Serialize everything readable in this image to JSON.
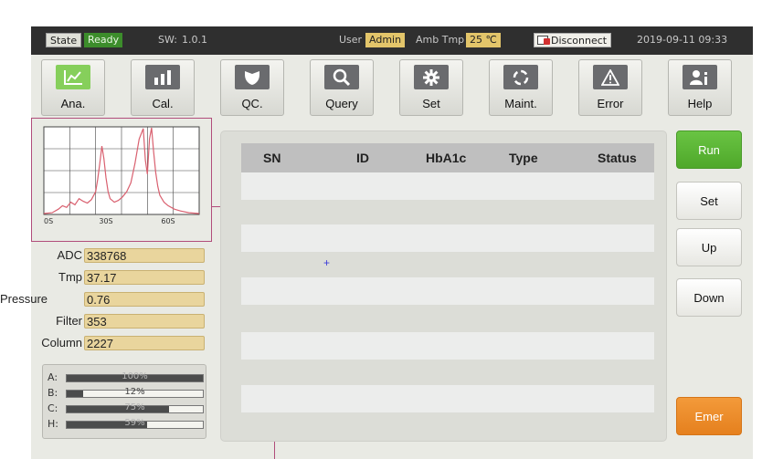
{
  "statusbar": {
    "state_label": "State",
    "state_value": "Ready",
    "sw_label": "SW:",
    "sw_version": "1.0.1",
    "user_label": "User",
    "user_value": "Admin",
    "amb_label": "Amb Tmp",
    "amb_value": "25 ℃",
    "connection": "Disconnect",
    "datetime": "2019-09-11 09:33"
  },
  "toolbar": [
    {
      "label": "Ana.",
      "icon": "line-chart-icon",
      "active": true
    },
    {
      "label": "Cal.",
      "icon": "bar-chart-icon",
      "active": false
    },
    {
      "label": "QC.",
      "icon": "shield-icon",
      "active": false
    },
    {
      "label": "Query",
      "icon": "search-icon",
      "active": false
    },
    {
      "label": "Set",
      "icon": "gear-icon",
      "active": false
    },
    {
      "label": "Maint.",
      "icon": "cycle-icon",
      "active": false
    },
    {
      "label": "Error",
      "icon": "warning-icon",
      "active": false
    },
    {
      "label": "Help",
      "icon": "user-info-icon",
      "active": false
    }
  ],
  "chart": {
    "x_ticks": [
      "0S",
      "30S",
      "60S"
    ],
    "colors": {
      "trace": "#d9606f",
      "grid": "#444444"
    }
  },
  "chart_data": {
    "type": "line",
    "x_ticks": [
      "0S",
      "30S",
      "60S"
    ],
    "xlim": [
      0,
      75
    ],
    "ylim": [
      0,
      100
    ],
    "grid": true,
    "series": [
      {
        "x": [
          0,
          4,
          7,
          9,
          11,
          13,
          15,
          17,
          19,
          21,
          23,
          25,
          26,
          27,
          28,
          29,
          30,
          31,
          32,
          34,
          36,
          38,
          40,
          42,
          44,
          46,
          48,
          49,
          50,
          51,
          52,
          53,
          54,
          55,
          56,
          58,
          60,
          63,
          66,
          70,
          75
        ],
        "y": [
          1,
          2,
          6,
          10,
          8,
          14,
          11,
          18,
          15,
          13,
          17,
          26,
          40,
          58,
          78,
          64,
          42,
          26,
          18,
          14,
          16,
          20,
          26,
          36,
          58,
          86,
          98,
          62,
          46,
          86,
          99,
          72,
          48,
          32,
          22,
          14,
          10,
          6,
          4,
          2,
          1
        ]
      }
    ]
  },
  "params": [
    {
      "label": "ADC",
      "value": "338768"
    },
    {
      "label": "Tmp",
      "value": "37.17"
    },
    {
      "label": "Pressure",
      "value": "0.76"
    },
    {
      "label": "Filter",
      "value": "353"
    },
    {
      "label": "Column",
      "value": "2227"
    }
  ],
  "levels": [
    {
      "label": "A:",
      "pct_text": "100%",
      "fraction": 1.0
    },
    {
      "label": "B:",
      "pct_text": "12%",
      "fraction": 0.12
    },
    {
      "label": "C:",
      "pct_text": "75%",
      "fraction": 0.75
    },
    {
      "label": "H:",
      "pct_text": "59%",
      "fraction": 0.59
    }
  ],
  "table": {
    "columns": [
      "SN",
      "ID",
      "HbA1c",
      "Type",
      "Status"
    ],
    "rows": [
      [
        "",
        "",
        "",
        "",
        ""
      ],
      [
        "",
        "",
        "",
        "",
        ""
      ],
      [
        "",
        "",
        "",
        "",
        ""
      ],
      [
        "",
        "",
        "",
        "",
        ""
      ],
      [
        "",
        "",
        "",
        "",
        ""
      ],
      [
        "",
        "",
        "",
        "",
        ""
      ],
      [
        "",
        "",
        "",
        "",
        ""
      ]
    ],
    "cursor_glyph": "+"
  },
  "side_buttons": {
    "run": "Run",
    "set": "Set",
    "up": "Up",
    "down": "Down",
    "emer": "Emer"
  },
  "colors": {
    "accent_green": "#86cf5b",
    "run_green": "#5cb535",
    "emer_orange": "#ec8a29",
    "param_yellow": "#e9d59d"
  }
}
